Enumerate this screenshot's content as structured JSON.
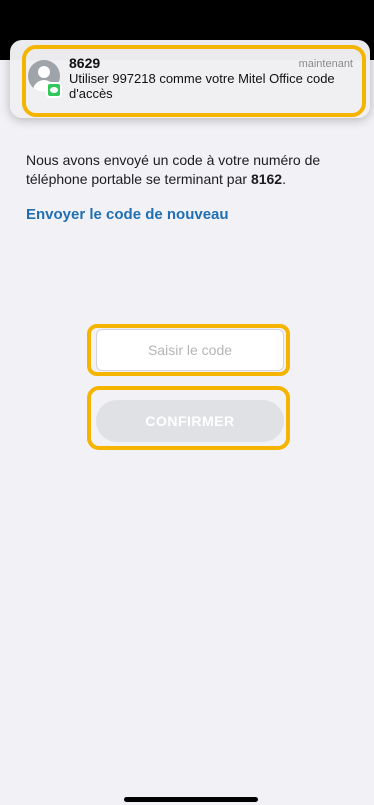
{
  "notification": {
    "sender": "8629",
    "time": "maintenant",
    "message": "Utiliser 997218 comme votre Mitel Office code d'accès",
    "avatar_icon": "contact-avatar-icon",
    "app_icon": "messages-icon"
  },
  "main": {
    "instruction_text": "Nous avons envoyé un code à votre numéro de téléphone portable se terminant par ",
    "phone_suffix": "8162",
    "instruction_end": ".",
    "resend_link": "Envoyer le code de nouveau",
    "code_input": {
      "placeholder": "Saisir le code",
      "value": ""
    },
    "confirm_button": "CONFIRMER"
  },
  "colors": {
    "highlight": "#f4b400",
    "link": "#1f6fb2",
    "button_disabled": "#dfe1e5",
    "background": "#f2f2f6"
  }
}
